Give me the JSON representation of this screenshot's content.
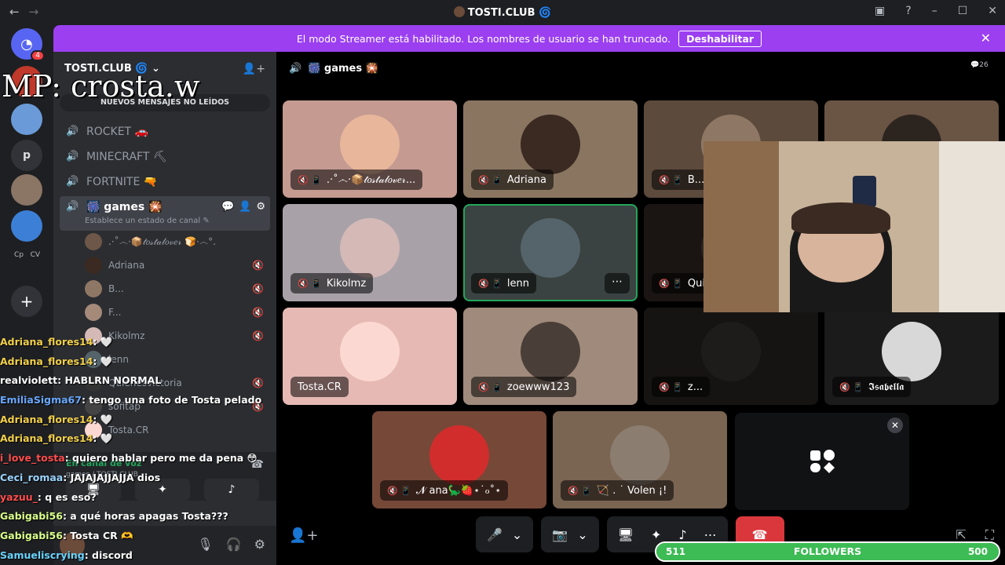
{
  "window": {
    "title": "TOSTI.CLUB",
    "back": "←",
    "forward": "→"
  },
  "banner": {
    "text": "El modo Streamer está habilitado. Los nombres de usuario se han truncado.",
    "disable_label": "Deshabilitar",
    "close": "✕"
  },
  "overlay": {
    "mp": "MP: crosta.w"
  },
  "guilds": {
    "badge": "4",
    "p_label": "p",
    "cp": "Cp",
    "cv": "CV"
  },
  "server": {
    "name": "TOSTI.CLUB",
    "new_messages": "NUEVOS MENSAJES NO LEÍDOS"
  },
  "channels": [
    {
      "name": "ROCKET 🚗"
    },
    {
      "name": "MINECRAFT ⛏"
    },
    {
      "name": "FORTNITE 🔫"
    },
    {
      "name": "🎆 games 🎇"
    }
  ],
  "channel_status": "Establece un estado de canal ✎",
  "voice_users": [
    {
      "name": ".·˚෴·📦𝓉𝑜𝓈𝓉𝒶𝓁𝑜𝓋𝑒𝓇 🍞·෴°."
    },
    {
      "name": "Adriana"
    },
    {
      "name": "B..."
    },
    {
      "name": "F..."
    },
    {
      "name": "Kikolmz"
    },
    {
      "name": "lenn"
    },
    {
      "name": "Quienesvictoria"
    },
    {
      "name": "sofitap"
    },
    {
      "name": "Tosta.CR"
    }
  ],
  "voice_bar": {
    "status": "En canal de voz",
    "sub": "games / TOSTI.CLUB"
  },
  "main": {
    "channel": "🎆 games 🎇",
    "count": "26"
  },
  "tiles": [
    {
      "name": ".·˚෴·📦𝓉𝑜𝓈𝓉𝒶𝓁𝑜𝓋𝑒𝓇...",
      "bg": "#c49a91",
      "av": "#e8b69b"
    },
    {
      "name": "Adriana",
      "bg": "#8a7561",
      "av": "#3a2a22"
    },
    {
      "name": "B...",
      "bg": "#5c4a3c",
      "av": "#8f7765"
    },
    {
      "name": "",
      "bg": "#6a5444",
      "av": "#2c241f"
    },
    {
      "name": "Kikolmz",
      "bg": "#a8a2a8",
      "av": "#d4b9b7"
    },
    {
      "name": "lenn",
      "bg": "#3a4341",
      "av": "#55646a"
    },
    {
      "name": "Qui...",
      "bg": "#1a1512",
      "av": "#2a2520"
    },
    {
      "name": "",
      "bg": "#1e1b1a",
      "av": "#2a2624"
    },
    {
      "name": "Tosta.CR",
      "bg": "#e6b9b4",
      "av": "#fcd8d2"
    },
    {
      "name": "zoewww123",
      "bg": "#a08a7c",
      "av": "#4a3f38"
    },
    {
      "name": "z...",
      "bg": "#161412",
      "av": "#1e1c1a"
    },
    {
      "name": "𝕴𝖘𝖆𝖇𝖊𝖑𝖑𝖆",
      "bg": "#1b1b1b",
      "av": "#d8d8d8"
    },
    {
      "name": "𝓝 ana🦕🍓⋆˙ℴ˚⋆",
      "bg": "#764838",
      "av": "#d12d2d"
    },
    {
      "name": "🏹 . ˙ Volen ¡!",
      "bg": "#7a6452",
      "av": "#8b7d70"
    }
  ],
  "controls": {
    "mic": "🎤",
    "cam": "📷",
    "screen": "🖥",
    "activity": "✦",
    "soundboard": "♪",
    "more": "⋯",
    "end": "☎",
    "chev": "⌄"
  },
  "chat": [
    {
      "user": "Adriana_flores14",
      "text": ": 🤍",
      "color": "#f2d04a"
    },
    {
      "user": "Adriana_flores14",
      "text": ": 🤍",
      "color": "#f2d04a"
    },
    {
      "user": "realviolett",
      "text": ": HABLRN NORMAL",
      "color": "#ffffff"
    },
    {
      "user": "EmiliaSigma67",
      "text": ": tengo una foto de Tosta pelado",
      "color": "#6aa8ff"
    },
    {
      "user": "Adriana_flores14",
      "text": ": 🤍",
      "color": "#f2d04a"
    },
    {
      "user": "Adriana_flores14",
      "text": ": 🤍",
      "color": "#f2d04a"
    },
    {
      "user": "i_love_tosta",
      "text": ": quiero hablar pero me da pena 😳",
      "color": "#ff4d4d"
    },
    {
      "user": "Ceci_romaa",
      "text": ": JAJAJAJJAJJA dios",
      "color": "#9ad4ff"
    },
    {
      "user": "yazuu_",
      "text": ": q es eso?",
      "color": "#ff4d4d"
    },
    {
      "user": "Gabigabi56",
      "text": ": a qué horas apagas Tosta???",
      "color": "#d9ff8a"
    },
    {
      "user": "Gabigabi56",
      "text": ": Tosta CR 🫶",
      "color": "#d9ff8a"
    },
    {
      "user": "Samueliscrying",
      "text": ": discord",
      "color": "#6ad4ff"
    }
  ],
  "followers": {
    "label": "FOLLOWERS",
    "current": "511",
    "goal": "500",
    "progress": 1
  }
}
